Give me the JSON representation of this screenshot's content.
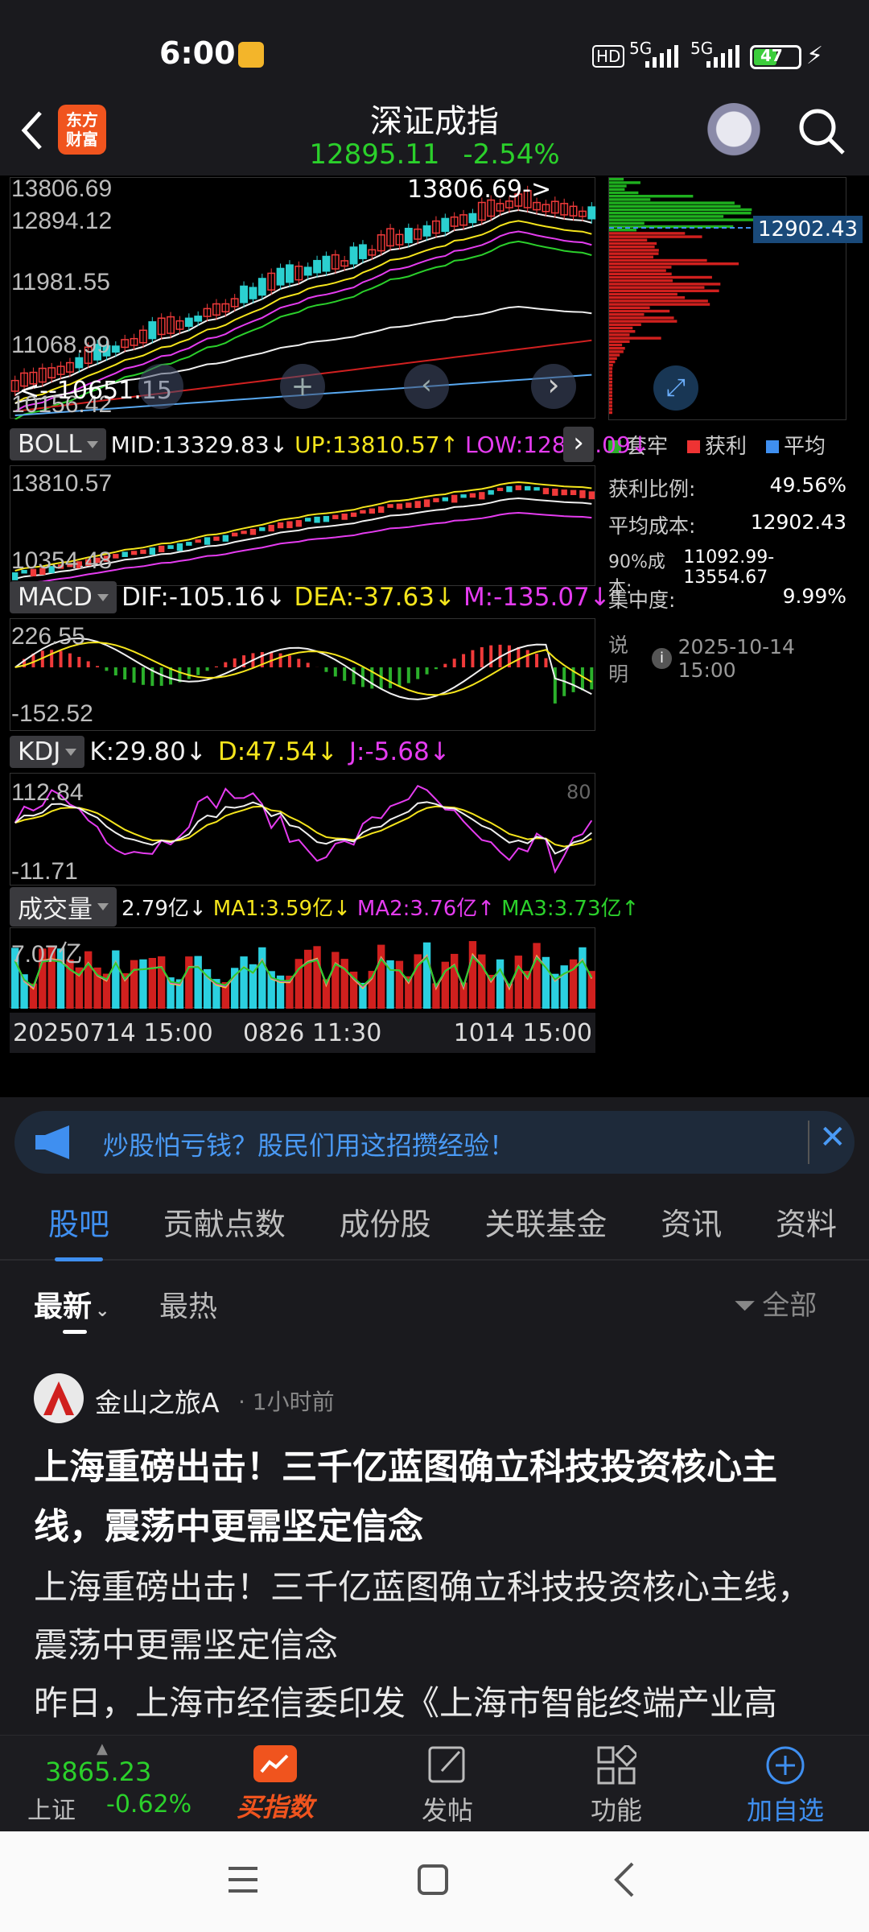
{
  "status": {
    "time": "6:00",
    "net1": "5G",
    "net2": "5G",
    "hd": "HD",
    "battery": "47"
  },
  "nav": {
    "title": "深证成指",
    "price": "12895.11",
    "change": "-2.54%",
    "logo_line1": "东方",
    "logo_line2": "财富"
  },
  "main_chart": {
    "left_labels": [
      "13806.69",
      "12894.12",
      "11981.55",
      "11068.99",
      "10156.42"
    ],
    "high_marker": "13806.69->",
    "low_marker": "<--10651.15",
    "chip_price": "12902.43"
  },
  "boll": {
    "tag": "BOLL",
    "mid": "MID:13329.83↓",
    "up": "UP:13810.57↑",
    "low": "LOW:12849.09↓",
    "top": "13810.57",
    "bottom": "10354.48"
  },
  "macd": {
    "tag": "MACD",
    "dif": "DIF:-105.16↓",
    "dea": "DEA:-37.63↓",
    "m": "M:-135.07↓",
    "top": "226.55",
    "bottom": "-152.52"
  },
  "kdj": {
    "tag": "KDJ",
    "k": "K:29.80↓",
    "d": "D:47.54↓",
    "j": "J:-5.68↓",
    "top": "112.84",
    "bottom": "-11.71",
    "right_tick": "80"
  },
  "volume": {
    "tag": "成交量",
    "val": "2.79亿↓",
    "ma1": "MA1:3.59亿↓",
    "ma2": "MA2:3.76亿↑",
    "ma3": "MA3:3.73亿↑",
    "top": "7.07亿"
  },
  "xaxis": {
    "start": "20250714 15:00",
    "mid": "0826 11:30",
    "end": "1014 15:00"
  },
  "chips": {
    "legend": [
      "套牢",
      "获利",
      "平均"
    ],
    "rows": [
      {
        "label": "获利比例:",
        "value": "49.56%"
      },
      {
        "label": "平均成本:",
        "value": "12902.43"
      },
      {
        "label": "90%成本:",
        "value": "11092.99-13554.67"
      },
      {
        "label": "集中度:",
        "value": "9.99%"
      }
    ],
    "note_label": "说明",
    "note_time": "2025-10-14 15:00"
  },
  "banner": {
    "text": "炒股怕亏钱？股民们用这招攒经验！"
  },
  "tabs": [
    "股吧",
    "贡献点数",
    "成份股",
    "关联基金",
    "资讯",
    "资料"
  ],
  "subtabs": {
    "latest": "最新",
    "hot": "最热",
    "filter": "全部"
  },
  "post": {
    "author": "金山之旅A",
    "time": "· 1小时前",
    "title": "上海重磅出击！三千亿蓝图确立科技投资核心主线，震荡中更需坚定信念",
    "body1": "上海重磅出击！三千亿蓝图确立科技投资核心主线，震荡中更需坚定信念",
    "body2": "昨日，上海市经信委印发《上海市智能终端产业高"
  },
  "bottom": {
    "index_price": "3865.23",
    "index_name": "上证",
    "index_change": "-0.62%",
    "buy": "买指数",
    "post": "发帖",
    "func": "功能",
    "add": "加自选"
  },
  "colors": {
    "accent": "#3f8ff0",
    "up": "#f03a3a",
    "down": "#2bd02b",
    "yellow": "#f5e51c"
  }
}
